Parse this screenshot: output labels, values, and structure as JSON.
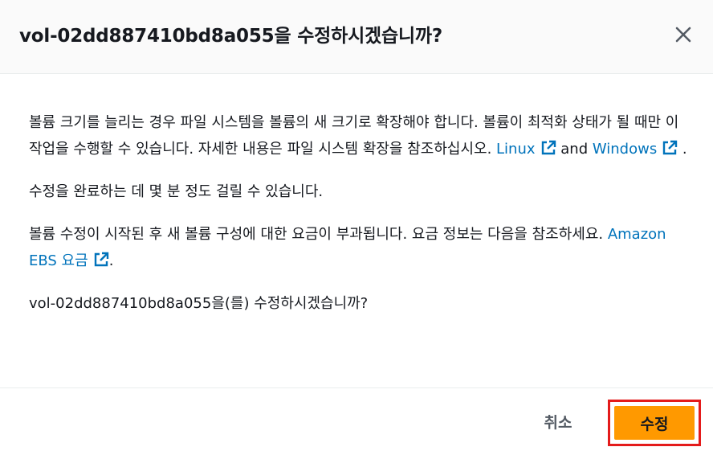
{
  "modal": {
    "title": "vol-02dd887410bd8a055을 수정하시겠습니까?",
    "close_icon": "close-icon"
  },
  "body": {
    "para1_text": "볼륨 크기를 늘리는 경우 파일 시스템을 볼륨의 새 크기로 확장해야 합니다. 볼륨이 최적화 상태가 될 때만 이 작업을 수행할 수 있습니다. 자세한 내용은 파일 시스템 확장을 참조하십시오. ",
    "link_linux": "Linux",
    "and_text": " and ",
    "link_windows": "Windows",
    "para1_end": " .",
    "para2_text": "수정을 완료하는 데 몇 분 정도 걸릴 수 있습니다.",
    "para3_text": "볼륨 수정이 시작된 후 새 볼륨 구성에 대한 요금이 부과됩니다. 요금 정보는 다음을 참조하세요. ",
    "link_pricing": "Amazon EBS 요금",
    "para3_end": ".",
    "para4_text": "vol-02dd887410bd8a055을(를) 수정하시겠습니까?",
    "external_icon": "external-link-icon"
  },
  "footer": {
    "cancel_label": "취소",
    "confirm_label": "수정"
  },
  "colors": {
    "link": "#0073bb",
    "primary": "#ff9900",
    "highlight_border": "#e41b1b"
  }
}
